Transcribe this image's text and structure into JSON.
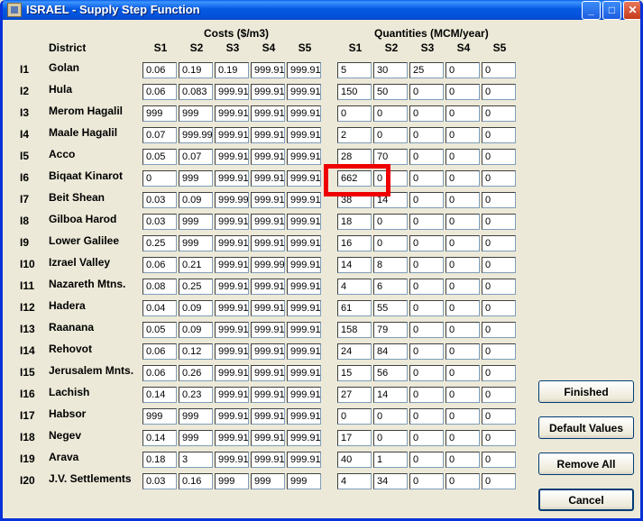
{
  "window": {
    "title": "ISRAEL - Supply Step Function",
    "min_label": "_",
    "max_label": "□",
    "close_label": "✕"
  },
  "headers": {
    "district": "District",
    "costs": "Costs ($/m3)",
    "quantities": "Quantities (MCM/year)",
    "steps": [
      "S1",
      "S2",
      "S3",
      "S4",
      "S5"
    ]
  },
  "rows": [
    {
      "id": "I1",
      "district": "Golan",
      "costs": [
        "0.06",
        "0.19",
        "0.19",
        "999.91",
        "999.91"
      ],
      "quantities": [
        "5",
        "30",
        "25",
        "0",
        "0"
      ]
    },
    {
      "id": "I2",
      "district": "Hula",
      "costs": [
        "0.06",
        "0.083",
        "999.91",
        "999.91",
        "999.91"
      ],
      "quantities": [
        "150",
        "50",
        "0",
        "0",
        "0"
      ]
    },
    {
      "id": "I3",
      "district": "Merom Hagalil",
      "costs": [
        "999",
        "999",
        "999.91",
        "999.91",
        "999.91"
      ],
      "quantities": [
        "0",
        "0",
        "0",
        "0",
        "0"
      ]
    },
    {
      "id": "I4",
      "district": "Maale Hagalil",
      "costs": [
        "0.07",
        "999.99",
        "999.91",
        "999.91",
        "999.91"
      ],
      "quantities": [
        "2",
        "0",
        "0",
        "0",
        "0"
      ]
    },
    {
      "id": "I5",
      "district": "Acco",
      "costs": [
        "0.05",
        "0.07",
        "999.91",
        "999.91",
        "999.91"
      ],
      "quantities": [
        "28",
        "70",
        "0",
        "0",
        "0"
      ]
    },
    {
      "id": "I6",
      "district": "Biqaat Kinarot",
      "costs": [
        "0",
        "999",
        "999.91",
        "999.91",
        "999.91"
      ],
      "quantities": [
        "662",
        "0",
        "0",
        "0",
        "0"
      ]
    },
    {
      "id": "I7",
      "district": "Beit Shean",
      "costs": [
        "0.03",
        "0.09",
        "999.99",
        "999.91",
        "999.91"
      ],
      "quantities": [
        "38",
        "14",
        "0",
        "0",
        "0"
      ]
    },
    {
      "id": "I8",
      "district": "Gilboa Harod",
      "costs": [
        "0.03",
        "999",
        "999.91",
        "999.91",
        "999.91"
      ],
      "quantities": [
        "18",
        "0",
        "0",
        "0",
        "0"
      ]
    },
    {
      "id": "I9",
      "district": "Lower Galilee",
      "costs": [
        "0.25",
        "999",
        "999.91",
        "999.91",
        "999.91"
      ],
      "quantities": [
        "16",
        "0",
        "0",
        "0",
        "0"
      ]
    },
    {
      "id": "I10",
      "district": "Izrael Valley",
      "costs": [
        "0.06",
        "0.21",
        "999.91",
        "999.99",
        "999.91"
      ],
      "quantities": [
        "14",
        "8",
        "0",
        "0",
        "0"
      ]
    },
    {
      "id": "I11",
      "district": "Nazareth Mtns.",
      "costs": [
        "0.08",
        "0.25",
        "999.91",
        "999.91",
        "999.91"
      ],
      "quantities": [
        "4",
        "6",
        "0",
        "0",
        "0"
      ]
    },
    {
      "id": "I12",
      "district": "Hadera",
      "costs": [
        "0.04",
        "0.09",
        "999.91",
        "999.91",
        "999.91"
      ],
      "quantities": [
        "61",
        "55",
        "0",
        "0",
        "0"
      ]
    },
    {
      "id": "I13",
      "district": "Raanana",
      "costs": [
        "0.05",
        "0.09",
        "999.91",
        "999.91",
        "999.91"
      ],
      "quantities": [
        "158",
        "79",
        "0",
        "0",
        "0"
      ]
    },
    {
      "id": "I14",
      "district": "Rehovot",
      "costs": [
        "0.06",
        "0.12",
        "999.91",
        "999.91",
        "999.91"
      ],
      "quantities": [
        "24",
        "84",
        "0",
        "0",
        "0"
      ]
    },
    {
      "id": "I15",
      "district": "Jerusalem Mnts.",
      "costs": [
        "0.06",
        "0.26",
        "999.91",
        "999.91",
        "999.91"
      ],
      "quantities": [
        "15",
        "56",
        "0",
        "0",
        "0"
      ]
    },
    {
      "id": "I16",
      "district": "Lachish",
      "costs": [
        "0.14",
        "0.23",
        "999.91",
        "999.91",
        "999.91"
      ],
      "quantities": [
        "27",
        "14",
        "0",
        "0",
        "0"
      ]
    },
    {
      "id": "I17",
      "district": "Habsor",
      "costs": [
        "999",
        "999",
        "999.91",
        "999.91",
        "999.91"
      ],
      "quantities": [
        "0",
        "0",
        "0",
        "0",
        "0"
      ]
    },
    {
      "id": "I18",
      "district": "Negev",
      "costs": [
        "0.14",
        "999",
        "999.91",
        "999.91",
        "999.91"
      ],
      "quantities": [
        "17",
        "0",
        "0",
        "0",
        "0"
      ]
    },
    {
      "id": "I19",
      "district": "Arava",
      "costs": [
        "0.18",
        "3",
        "999.91",
        "999.91",
        "999.91"
      ],
      "quantities": [
        "40",
        "1",
        "0",
        "0",
        "0"
      ]
    },
    {
      "id": "I20",
      "district": "J.V. Settlements",
      "costs": [
        "0.03",
        "0.16",
        "999",
        "999",
        "999"
      ],
      "quantities": [
        "4",
        "34",
        "0",
        "0",
        "0"
      ]
    }
  ],
  "buttons": {
    "finished": "Finished",
    "default_values": "Default Values",
    "remove_all": "Remove All",
    "cancel": "Cancel"
  },
  "highlight_color": "#ee0000"
}
